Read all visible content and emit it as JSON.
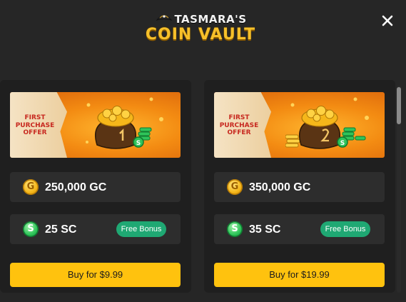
{
  "header": {
    "logo_line1": "TASMARA'S",
    "logo_line2": "COIN VAULT",
    "close_icon": "close-icon"
  },
  "packages": [
    {
      "banner_line1": "FIRST",
      "banner_line2": "PURCHASE",
      "banner_line3": "OFFER",
      "banner_badge_digit": "1",
      "gc_amount": "250,000 GC",
      "gc_coin_letter": "G",
      "sc_amount": "25 SC",
      "sc_coin_letter": "S",
      "bonus_label": "Free Bonus",
      "buy_label": "Buy for $9.99"
    },
    {
      "banner_line1": "FIRST",
      "banner_line2": "PURCHASE",
      "banner_line3": "OFFER",
      "banner_badge_digit": "2",
      "gc_amount": "350,000 GC",
      "gc_coin_letter": "G",
      "sc_amount": "35 SC",
      "sc_coin_letter": "S",
      "bonus_label": "Free Bonus",
      "buy_label": "Buy for $19.99"
    }
  ],
  "colors": {
    "background": "#262626",
    "card": "#1f1f1f",
    "row": "#2d2d2d",
    "buy_button": "#ffc20e",
    "bonus_badge": "#1fa873",
    "logo_gold": "#f6c02a"
  }
}
